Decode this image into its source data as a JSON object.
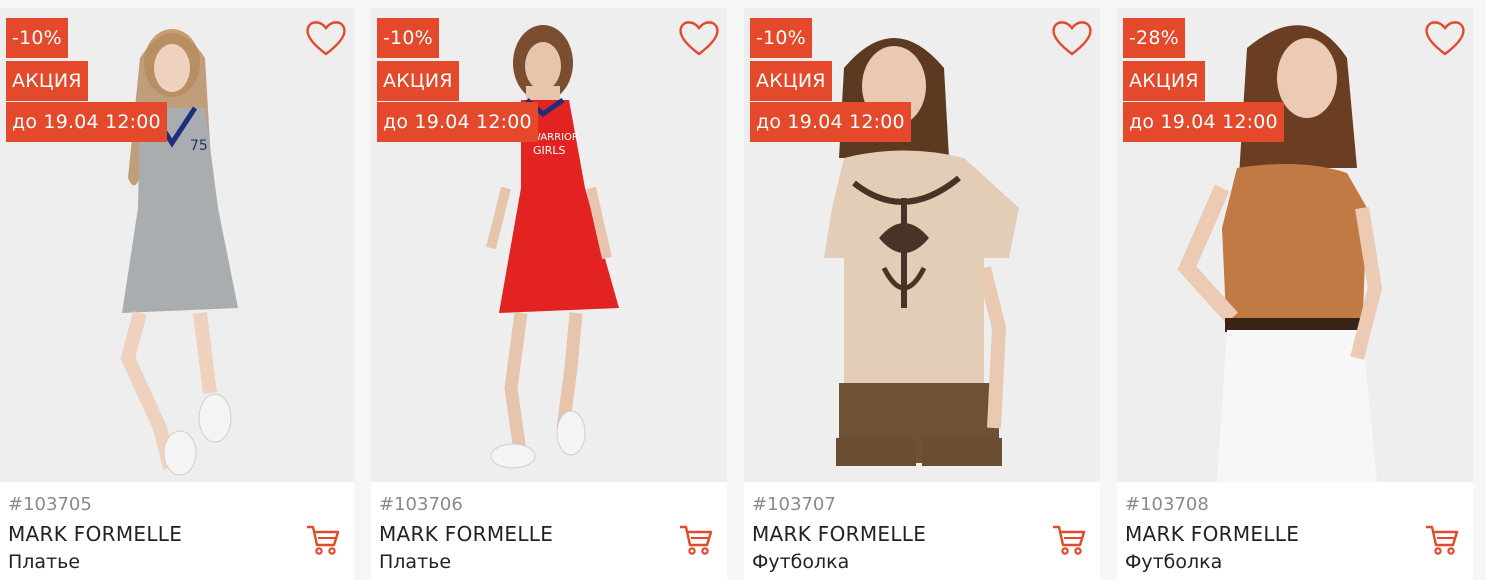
{
  "accent_color": "#e3492a",
  "products": [
    {
      "discount": "-10%",
      "promo": "АКЦИЯ",
      "until": "до 19.04 12:00",
      "sku": "#103705",
      "brand": "MARK FORMELLE",
      "type": "Платье",
      "garment_color": "#a9adaf"
    },
    {
      "discount": "-10%",
      "promo": "АКЦИЯ",
      "until": "до 19.04 12:00",
      "sku": "#103706",
      "brand": "MARK FORMELLE",
      "type": "Платье",
      "garment_color": "#e32222"
    },
    {
      "discount": "-10%",
      "promo": "АКЦИЯ",
      "until": "до 19.04 12:00",
      "sku": "#103707",
      "brand": "MARK FORMELLE",
      "type": "Футболка",
      "garment_color": "#e3cdb6"
    },
    {
      "discount": "-28%",
      "promo": "АКЦИЯ",
      "until": "до 19.04 12:00",
      "sku": "#103708",
      "brand": "MARK FORMELLE",
      "type": "Футболка",
      "garment_color": "#c27a45"
    }
  ]
}
